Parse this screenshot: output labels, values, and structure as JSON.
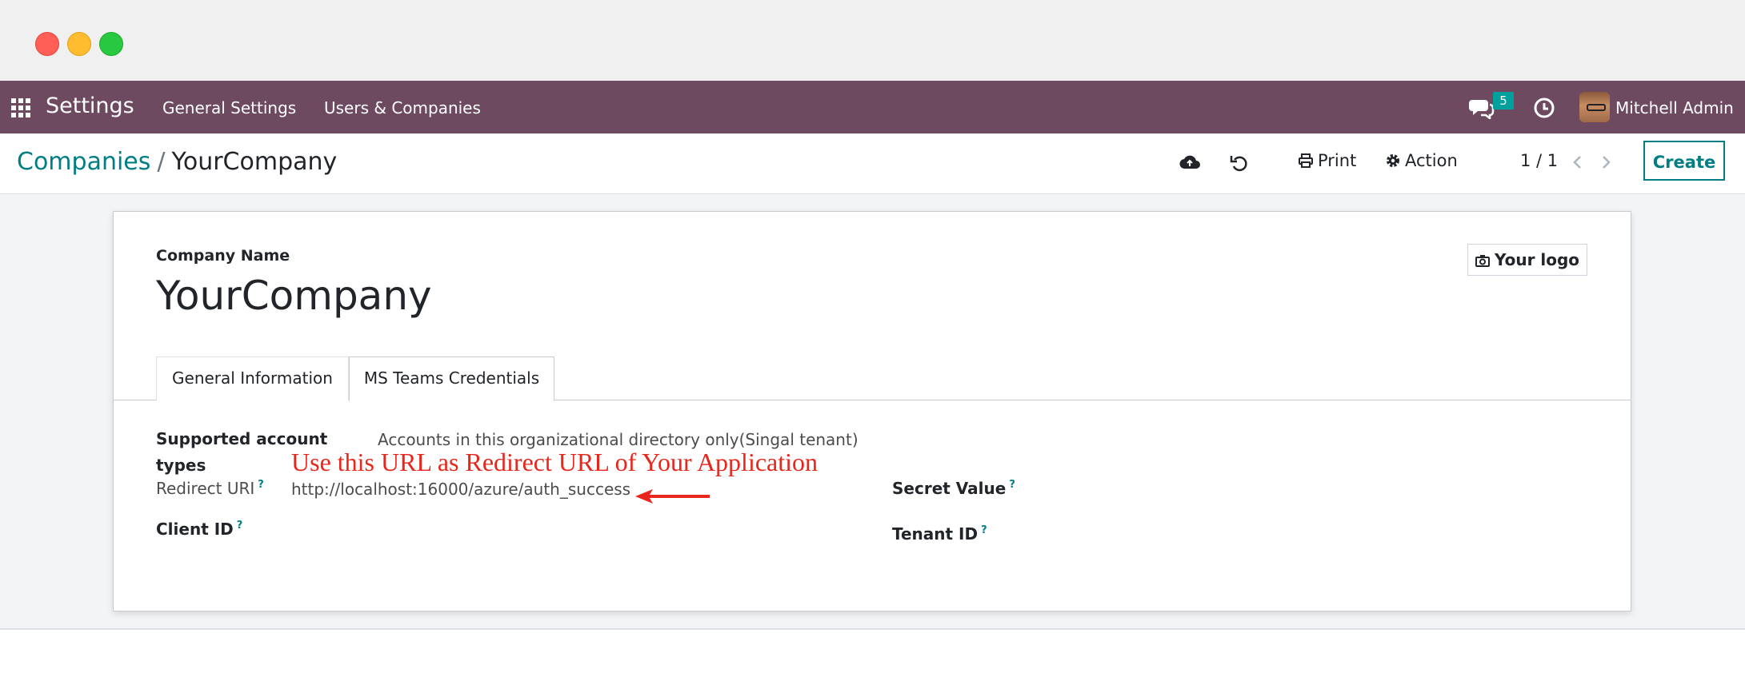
{
  "navbar": {
    "app_name": "Settings",
    "menu": [
      "General Settings",
      "Users & Companies"
    ],
    "message_count": "5",
    "user_name": "Mitchell Admin"
  },
  "control_panel": {
    "breadcrumb_parent": "Companies",
    "breadcrumb_separator": "/",
    "breadcrumb_current": "YourCompany",
    "print_label": "Print",
    "action_label": "Action",
    "pager": "1 / 1",
    "create_label": "Create"
  },
  "form": {
    "company_name_label": "Company Name",
    "company_name": "YourCompany",
    "logo_label": "Your logo",
    "tabs": [
      "General Information",
      "MS Teams Credentials"
    ],
    "active_tab": "MS Teams Credentials",
    "fields": {
      "supported_account_types_label_1": "Supported account",
      "supported_account_types_label_2": "types",
      "supported_account_types_value": "Accounts in this organizational directory only(Singal tenant)",
      "redirect_uri_label": "Redirect URI",
      "redirect_uri_value": "http://localhost:16000/azure/auth_success",
      "client_id_label": "Client ID",
      "secret_value_label": "Secret Value",
      "tenant_id_label": "Tenant ID"
    },
    "help_marker": "?",
    "annotation": "Use this URL as Redirect URL of Your Application"
  },
  "colors": {
    "navbar": "#6e4a60",
    "brand_teal": "#017e84",
    "badge": "#00a09d",
    "annotation_red": "#e8261c"
  },
  "icons": [
    "apps-grid-icon",
    "chat-icon",
    "clock-icon",
    "cloud-upload-icon",
    "undo-icon",
    "print-icon",
    "gear-icon",
    "chevron-left-icon",
    "chevron-right-icon",
    "camera-icon",
    "red-arrow-icon"
  ]
}
